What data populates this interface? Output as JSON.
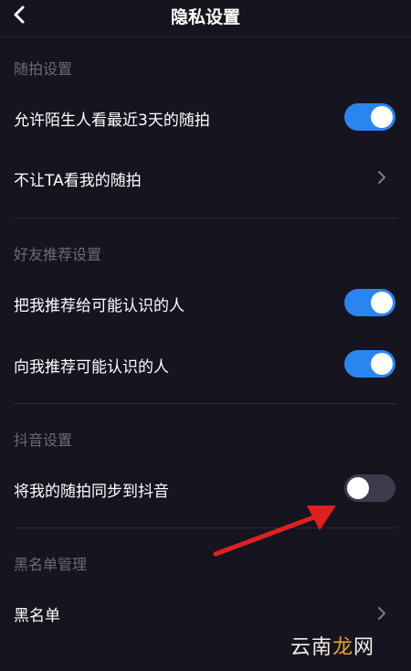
{
  "header": {
    "title": "隐私设置",
    "back_icon": "chevron-left-icon"
  },
  "sections": {
    "random_shot": {
      "title": "随拍设置",
      "allow_strangers": {
        "label": "允许陌生人看最近3天的随拍",
        "enabled": true
      },
      "hide_from": {
        "label": "不让TA看我的随拍"
      }
    },
    "friend_recommend": {
      "title": "好友推荐设置",
      "recommend_me": {
        "label": "把我推荐给可能认识的人",
        "enabled": true
      },
      "recommend_to_me": {
        "label": "向我推荐可能认识的人",
        "enabled": true
      }
    },
    "douyin": {
      "title": "抖音设置",
      "sync": {
        "label": "将我的随拍同步到抖音",
        "enabled": false
      }
    },
    "blacklist": {
      "title": "黑名单管理",
      "list": {
        "label": "黑名单"
      }
    }
  },
  "colors": {
    "toggle_on": "#2b85f0",
    "toggle_off": "#3c3b4e",
    "annotation_arrow": "#e02020"
  },
  "watermark": {
    "part1": "云南",
    "part2": "龙",
    "part3": "网"
  }
}
